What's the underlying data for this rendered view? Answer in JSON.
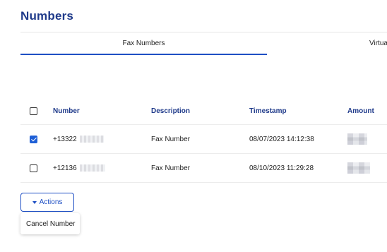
{
  "page": {
    "title": "Numbers"
  },
  "tabs": [
    {
      "label": "Fax Numbers",
      "active": true
    },
    {
      "label": "Virtua",
      "active": false
    }
  ],
  "table": {
    "columns": [
      "Number",
      "Description",
      "Timestamp",
      "Amount"
    ],
    "header_checkbox_checked": false,
    "rows": [
      {
        "number": "+13322",
        "description": "Fax Number",
        "timestamp": "08/07/2023 14:12:38",
        "checked": true
      },
      {
        "number": "+12136",
        "description": "Fax Number",
        "timestamp": "08/10/2023 11:29:28",
        "checked": false
      }
    ]
  },
  "actions": {
    "button_label": "Actions",
    "menu_items": [
      "Cancel Number"
    ]
  },
  "colors": {
    "accent": "#1e4fc4",
    "title": "#1f3a8a",
    "checkbox_checked": "#1e5fd6"
  },
  "icons": {
    "actions_caret": "caret-down-icon",
    "row_checkbox": "checkbox-icon"
  }
}
